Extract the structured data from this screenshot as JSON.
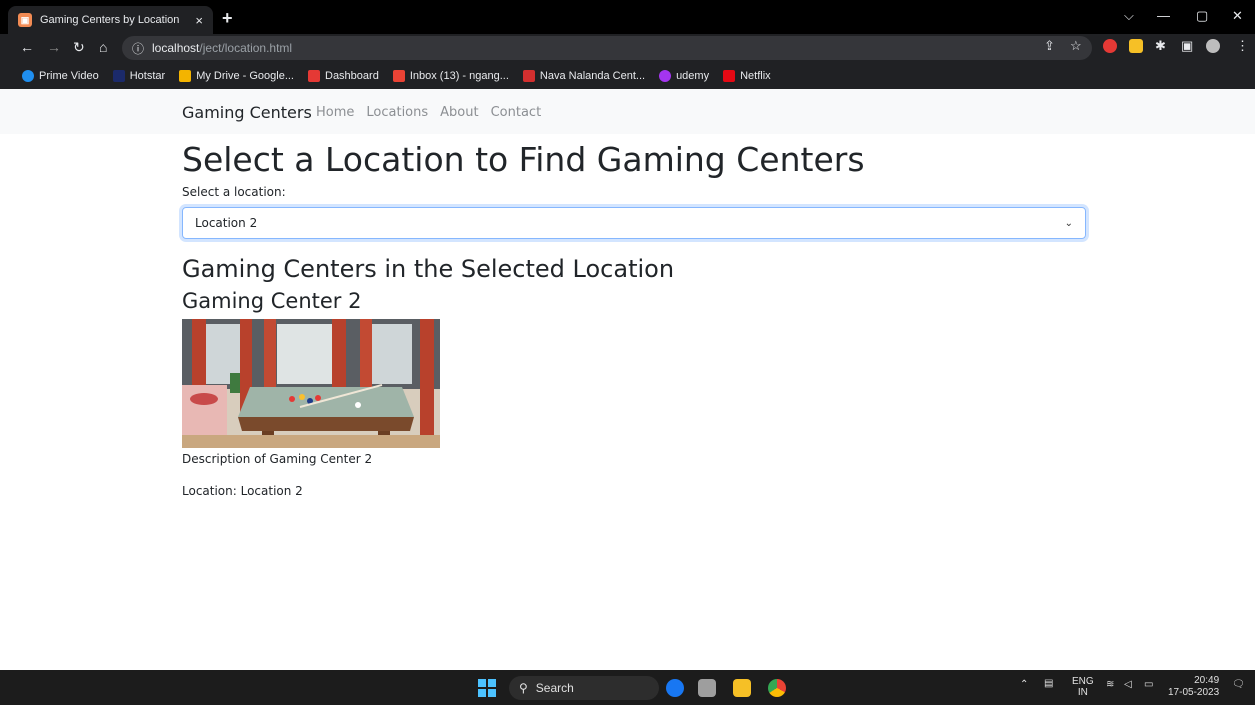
{
  "browser": {
    "tab_title": "Gaming Centers by Location",
    "tab_close": "×",
    "new_tab": "+",
    "url_host": "localhost",
    "url_path": "/ject/location.html",
    "bookmarks": [
      {
        "label": "Prime Video",
        "icon": "prime-video-icon",
        "color": "#1f8ff0"
      },
      {
        "label": "Hotstar",
        "icon": "hotstar-icon",
        "color": "#1b2a6b"
      },
      {
        "label": "My Drive - Google...",
        "icon": "drive-icon",
        "color": "#f4b400"
      },
      {
        "label": "Dashboard",
        "icon": "dashboard-icon",
        "color": "#e53935"
      },
      {
        "label": "Inbox (13) - ngang...",
        "icon": "gmail-icon",
        "color": "#ea4335"
      },
      {
        "label": "Nava Nalanda Cent...",
        "icon": "nava-nalanda-icon",
        "color": "#d32f2f"
      },
      {
        "label": "udemy",
        "icon": "udemy-icon",
        "color": "#a435f0"
      },
      {
        "label": "Netflix",
        "icon": "netflix-icon",
        "color": "#e50914"
      }
    ]
  },
  "navbar": {
    "brand": "Gaming Centers",
    "links": [
      "Home",
      "Locations",
      "About",
      "Contact"
    ]
  },
  "main": {
    "heading": "Select a Location to Find Gaming Centers",
    "select_label": "Select a location:",
    "selected_location": "Location 2",
    "results_heading": "Gaming Centers in the Selected Location",
    "center_name": "Gaming Center 2",
    "center_description": "Description of Gaming Center 2",
    "center_location": "Location: Location 2"
  },
  "taskbar": {
    "search_placeholder": "Search",
    "lang_top": "ENG",
    "lang_bottom": "IN",
    "time": "20:49",
    "date": "17-05-2023"
  }
}
